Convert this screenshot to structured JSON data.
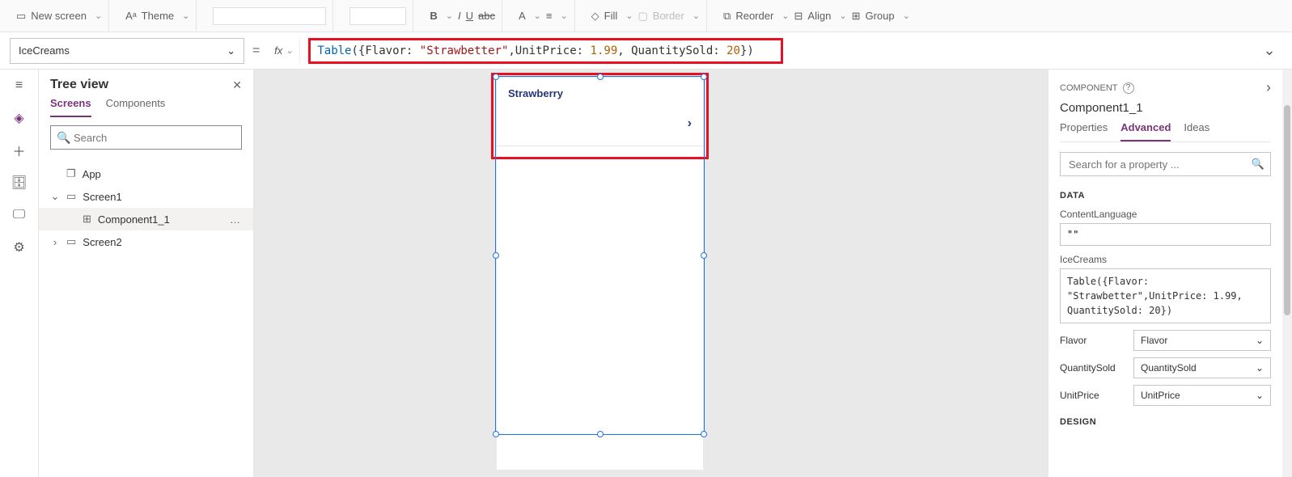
{
  "toolbar": {
    "new_screen": "New screen",
    "theme": "Theme",
    "bold": "B",
    "italic": "I",
    "underline": "U",
    "strike": "abc",
    "fontcolor": "A",
    "align": "≡",
    "fill": "Fill",
    "border": "Border",
    "reorder": "Reorder",
    "align2": "Align",
    "group": "Group"
  },
  "formula": {
    "property": "IceCreams",
    "fx": "fx",
    "tokens": {
      "fn": "Table",
      "open": "({Flavor: ",
      "str": "\"Strawbetter\"",
      "mid": ",UnitPrice: ",
      "num1": "1.99",
      "mid2": ", QuantitySold: ",
      "num2": "20",
      "close": "})"
    }
  },
  "tree": {
    "title": "Tree view",
    "tabs": {
      "screens": "Screens",
      "components": "Components"
    },
    "search_ph": "Search",
    "app": "App",
    "screen1": "Screen1",
    "component": "Component1_1",
    "screen2": "Screen2"
  },
  "canvas": {
    "row_title": "Strawberry"
  },
  "panel": {
    "component_label": "COMPONENT",
    "component_name": "Component1_1",
    "tabs": {
      "properties": "Properties",
      "advanced": "Advanced",
      "ideas": "Ideas"
    },
    "search_ph": "Search for a property ...",
    "data_label": "DATA",
    "content_language_label": "ContentLanguage",
    "content_language_value": "\"\"",
    "icecreams_label": "IceCreams",
    "icecreams_value": "Table({Flavor: \"Strawbetter\",UnitPrice: 1.99, QuantitySold: 20})",
    "map": {
      "flavor_label": "Flavor",
      "flavor_value": "Flavor",
      "qty_label": "QuantitySold",
      "qty_value": "QuantitySold",
      "price_label": "UnitPrice",
      "price_value": "UnitPrice"
    },
    "design_label": "DESIGN"
  }
}
